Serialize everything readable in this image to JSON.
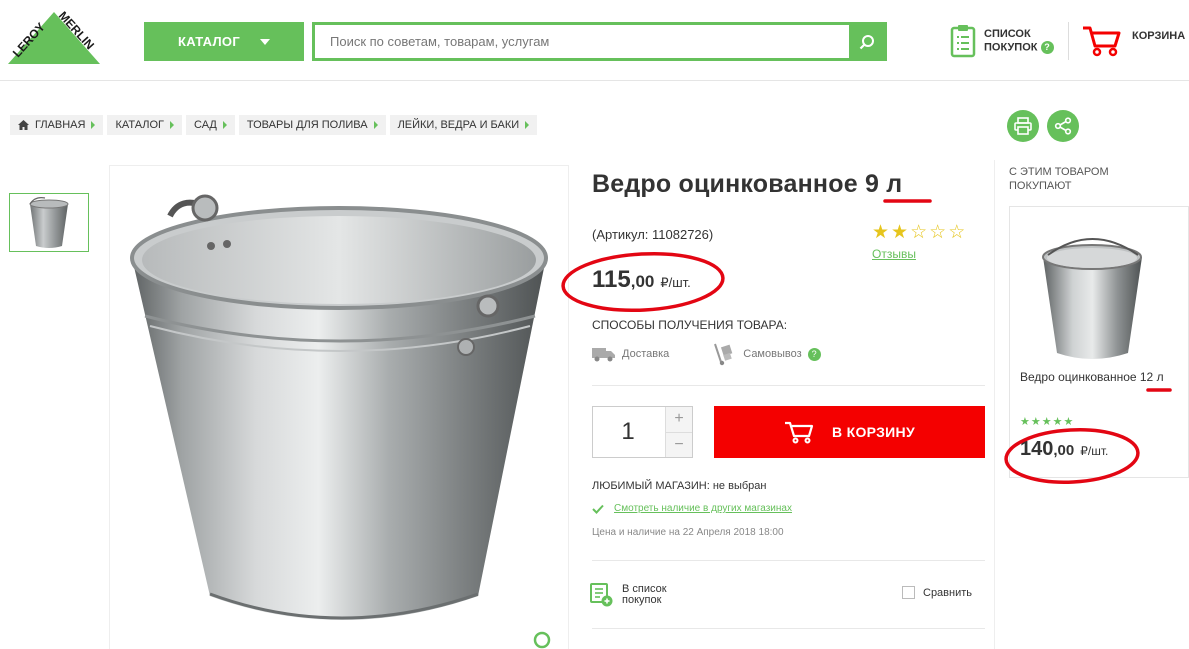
{
  "header": {
    "logo_text_top": "LEROY",
    "logo_text_bottom": "MERLIN",
    "catalog_label": "КАТАЛОГ",
    "search_placeholder": "Поиск по советам, товарам, услугам",
    "shoplist_line1": "СПИСОК",
    "shoplist_line2": "ПОКУПОК",
    "cart_label": "КОРЗИНА",
    "accent_color": "#66c05b"
  },
  "breadcrumb": [
    {
      "label": "ГЛАВНАЯ",
      "icon": "home-icon"
    },
    {
      "label": "КАТАЛОГ"
    },
    {
      "label": "САД"
    },
    {
      "label": "ТОВАРЫ ДЛЯ ПОЛИВА"
    },
    {
      "label": "ЛЕЙКИ, ВЕДРА И БАКИ"
    }
  ],
  "product": {
    "title": "Ведро оцинкованное 9 л",
    "article": "(Артикул: 11082726)",
    "rating": 2,
    "rating_max": 5,
    "reviews_label": "Отзывы",
    "price_int": "115",
    "price_dec": ",00",
    "price_unit": "₽/шт.",
    "delivery_title": "СПОСОБЫ ПОЛУЧЕНИЯ ТОВАРА:",
    "delivery_options": [
      "Доставка",
      "Самовывоз"
    ],
    "quantity": "1",
    "add_to_cart_label": "В КОРЗИНУ",
    "cart_button_color": "#f40000",
    "favorite_store": "ЛЮБИМЫЙ МАГАЗИН: не выбран",
    "check_stock_label": "Смотреть наличие в других магазинах",
    "price_date": "Цена и наличие на 22 Апреля 2018 18:00",
    "to_list_line1": "В список",
    "to_list_line2": "покупок",
    "compare_label": "Сравнить"
  },
  "side": {
    "title": "С ЭТИМ ТОВАРОМ ПОКУПАЮТ",
    "item_name": "Ведро оцинкованное 12 л",
    "item_price_int": "140",
    "item_price_dec": ",00",
    "item_price_unit": "₽/шт."
  },
  "annotation_color": "#e30613"
}
